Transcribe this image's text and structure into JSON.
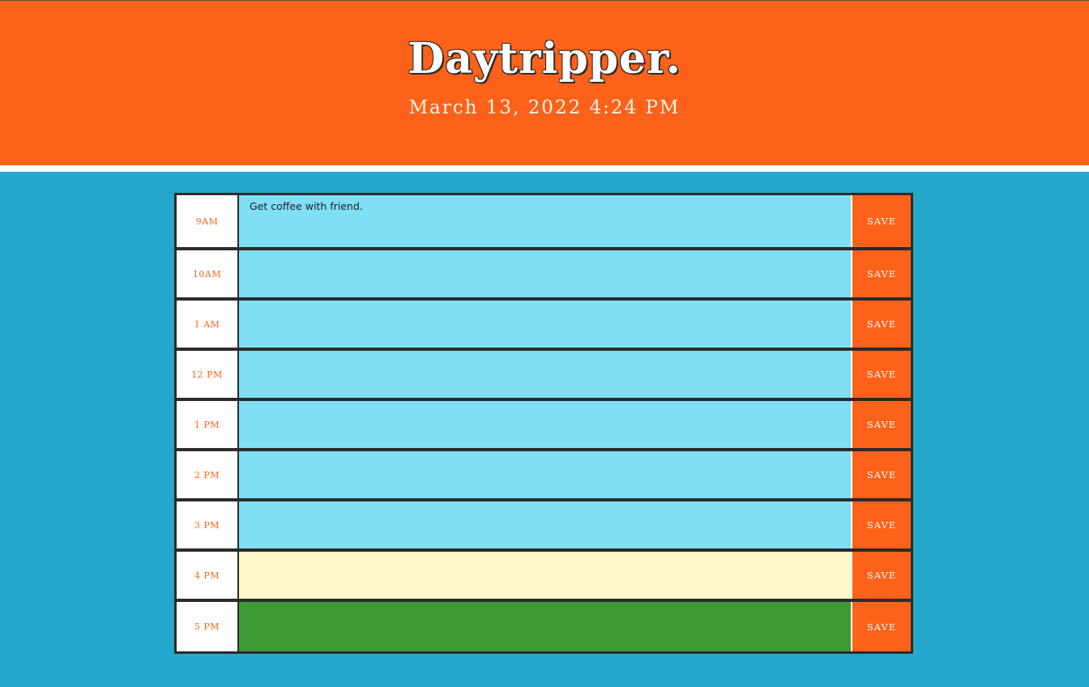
{
  "header": {
    "title": "Daytripper.",
    "datetime": "March 13, 2022 4:24 PM"
  },
  "colors": {
    "header_bg": "#fe6119",
    "page_bg": "#24a8cb",
    "past": "#7edff5",
    "present": "#fff8c8",
    "future": "#3e9a35",
    "save_bg": "#fe6119"
  },
  "planner": {
    "save_label": "SAVE",
    "rows": [
      {
        "hour": "9AM",
        "text": "Get coffee with friend.",
        "state": "past"
      },
      {
        "hour": "10AM",
        "text": "",
        "state": "past"
      },
      {
        "hour": "1 AM",
        "text": "",
        "state": "past"
      },
      {
        "hour": "12 PM",
        "text": "",
        "state": "past"
      },
      {
        "hour": "1 PM",
        "text": "",
        "state": "past"
      },
      {
        "hour": "2 PM",
        "text": "",
        "state": "past"
      },
      {
        "hour": "3 PM",
        "text": "",
        "state": "past"
      },
      {
        "hour": "4 PM",
        "text": "",
        "state": "present"
      },
      {
        "hour": "5 PM",
        "text": "",
        "state": "future"
      }
    ]
  }
}
